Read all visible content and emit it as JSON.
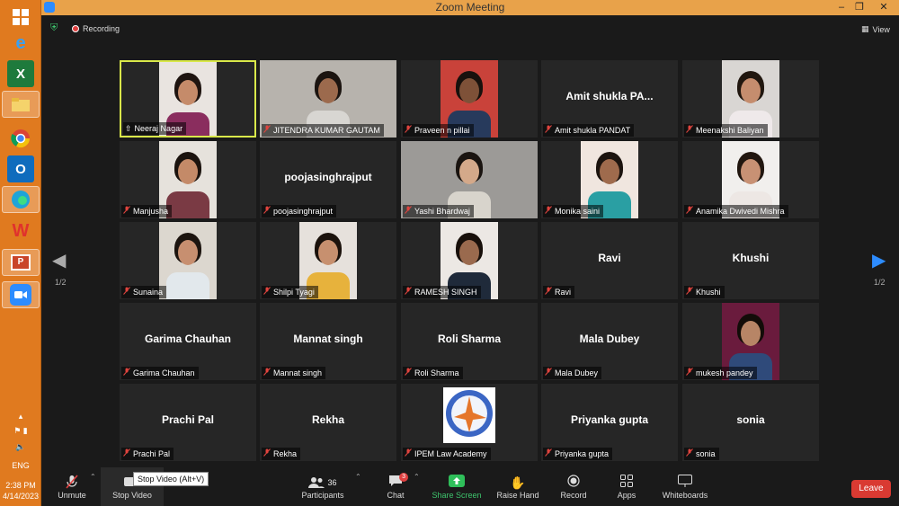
{
  "window": {
    "title": "Zoom Meeting"
  },
  "header": {
    "recording": "Recording",
    "view": "View"
  },
  "taskbar": {
    "lang": "ENG",
    "time": "2:38 PM",
    "date": "4/14/2023"
  },
  "pagination": {
    "left": "1/2",
    "right": "1/2"
  },
  "tiles": [
    {
      "name": "Neeraj Nagar",
      "video": true,
      "speaker": true,
      "icon": "pin-icon"
    },
    {
      "name": "JITENDRA KUMAR GAUTAM",
      "video": true
    },
    {
      "name": "Praveen n pillai",
      "video": true
    },
    {
      "name": "Amit shukla PANDAT",
      "display": "Amit shukla PA..."
    },
    {
      "name": "Meenakshi Baliyan",
      "video": true
    },
    {
      "name": "Manjusha",
      "video": true
    },
    {
      "name": "poojasinghrajput",
      "display": "poojasinghrajput"
    },
    {
      "name": "Yashi Bhardwaj",
      "video": true
    },
    {
      "name": "Monika saini",
      "video": true
    },
    {
      "name": "Anamika Dwivedi Mishra",
      "video": true
    },
    {
      "name": "Sunaina",
      "video": true
    },
    {
      "name": "Shilpi Tyagi",
      "video": true
    },
    {
      "name": "RAMESH SINGH",
      "video": true
    },
    {
      "name": "Ravi",
      "display": "Ravi"
    },
    {
      "name": "Khushi",
      "display": "Khushi"
    },
    {
      "name": "Garima Chauhan",
      "display": "Garima Chauhan"
    },
    {
      "name": "Mannat singh",
      "display": "Mannat singh"
    },
    {
      "name": "Roli Sharma",
      "display": "Roli Sharma"
    },
    {
      "name": "Mala Dubey",
      "display": "Mala Dubey"
    },
    {
      "name": "mukesh pandey",
      "video": true
    },
    {
      "name": "Prachi Pal",
      "display": "Prachi Pal"
    },
    {
      "name": "Rekha",
      "display": "Rekha"
    },
    {
      "name": "IPEM Law Academy",
      "video": true,
      "logo": true
    },
    {
      "name": "Priyanka gupta",
      "display": "Priyanka gupta"
    },
    {
      "name": "sonia",
      "display": "sonia"
    }
  ],
  "toolbar": {
    "unmute": "Unmute",
    "stop_video": "Stop Video",
    "tooltip": "Stop Video (Alt+V)",
    "participants": "Participants",
    "participants_count": "36",
    "chat": "Chat",
    "chat_badge": "3",
    "share_screen": "Share Screen",
    "raise_hand": "Raise Hand",
    "record": "Record",
    "apps": "Apps",
    "whiteboards": "Whiteboards",
    "leave": "Leave"
  },
  "colors": {
    "speaker_border": "#d9e84a",
    "taskbar": "#e07a1f",
    "leave": "#d93a32",
    "share": "#2fbf5a"
  }
}
